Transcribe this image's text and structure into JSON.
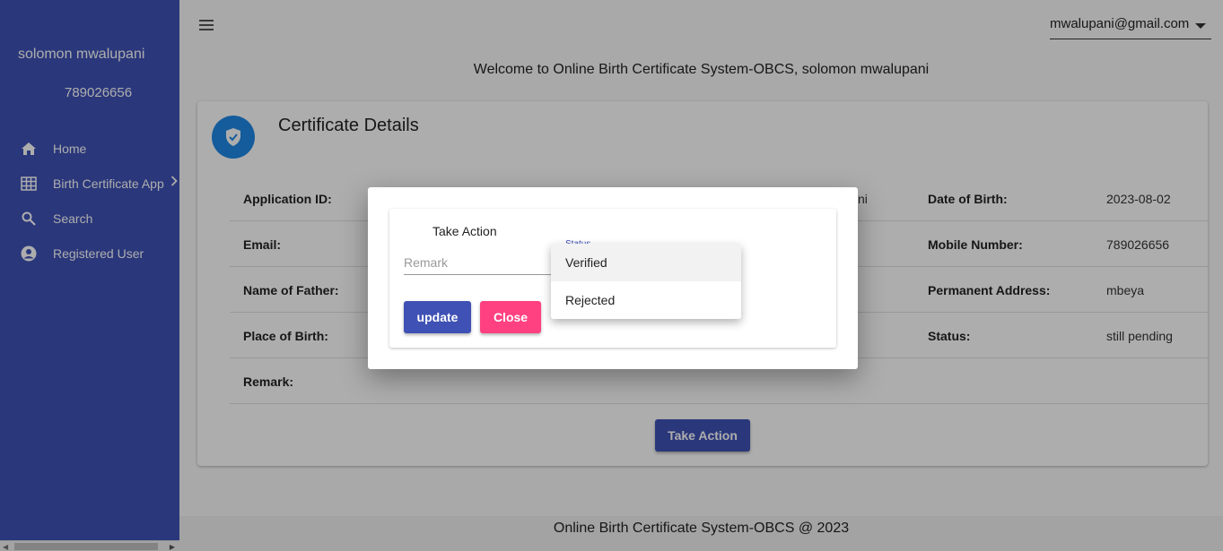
{
  "sidebar": {
    "user_name": "solomon mwalupani",
    "user_phone": "789026656",
    "items": [
      {
        "label": "Home",
        "icon": "home-icon"
      },
      {
        "label": "Birth Certificate App",
        "icon": "grid-icon"
      },
      {
        "label": "Search",
        "icon": "search-icon"
      },
      {
        "label": "Registered User",
        "icon": "account-circle-icon"
      }
    ]
  },
  "header": {
    "user_email": "mwalupani@gmail.com"
  },
  "welcome": "Welcome to Online Birth Certificate System-OBCS, solomon mwalupani",
  "card": {
    "title": "Certificate Details",
    "rows": [
      {
        "left_label": "Application ID:",
        "fragment": "ni",
        "right_label": "Date of Birth:",
        "right_value": "2023-08-02"
      },
      {
        "left_label": "Email:",
        "fragment": "",
        "right_label": "Mobile Number:",
        "right_value": "789026656"
      },
      {
        "left_label": "Name of Father:",
        "fragment": "",
        "right_label": "Permanent Address:",
        "right_value": "mbeya"
      },
      {
        "left_label": "Place of Birth:",
        "fragment": "",
        "right_label": "Status:",
        "right_value": "still pending"
      },
      {
        "left_label": "Remark:",
        "fragment": "",
        "right_label": "",
        "right_value": ""
      }
    ],
    "take_action_label": "Take Action"
  },
  "footer": "Online Birth Certificate System-OBCS @ 2023",
  "dialog": {
    "title": "Take Action",
    "remark_placeholder": "Remark",
    "status_label": "Status",
    "status_options": [
      "Verified",
      "Rejected"
    ],
    "update_label": "update",
    "close_label": "Close"
  },
  "colors": {
    "primary": "#3f51b5",
    "accent": "#ff4081",
    "badge": "#1e88e5"
  }
}
